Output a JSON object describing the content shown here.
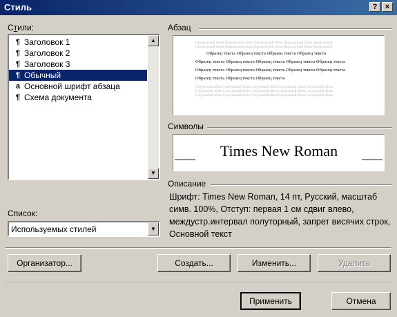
{
  "window": {
    "title": "Стиль",
    "help_glyph": "?",
    "close_glyph": "×"
  },
  "styles_label_prefix": "С",
  "styles_label_accel": "т",
  "styles_label_suffix": "или:",
  "styles": [
    {
      "icon": "¶",
      "label": "Заголовок 1",
      "selected": false
    },
    {
      "icon": "¶",
      "label": "Заголовок 2",
      "selected": false
    },
    {
      "icon": "¶",
      "label": "Заголовок 3",
      "selected": false
    },
    {
      "icon": "¶",
      "label": "Обычный",
      "selected": true
    },
    {
      "icon": "a",
      "label": "Основной шрифт абзаца",
      "selected": false
    },
    {
      "icon": "¶",
      "label": "Схема документа",
      "selected": false
    }
  ],
  "list_label_prefix": "Список",
  "list_label_suffix": ":",
  "list_value": "Используемых стилей",
  "paragraph_label": "Абзац",
  "paragraph_sample": [
    "Образец текста Образец текста Образец текста Образец текста",
    "Образец текста Образец текста Образец текста Образец текста Образец текста",
    "Образец текста Образец текста Образец текста Образец текста Образец текста",
    "Образец текста Образец текста Образец текста"
  ],
  "symbols_label": "Символы",
  "font_sample": "Times New Roman",
  "description_label": "Описание",
  "description": "Шрифт: Times New Roman, 14 пт, Русский, масштаб симв. 100%, Отступ:  первая  1 см сдвиг влево, междустр.интервал полуторный, запрет висячих строк, Основной текст",
  "buttons": {
    "organizer": "Организатор...",
    "create": "Создать...",
    "modify": "Изменить...",
    "delete": "Удалить",
    "apply": "Применить",
    "cancel": "Отмена"
  }
}
